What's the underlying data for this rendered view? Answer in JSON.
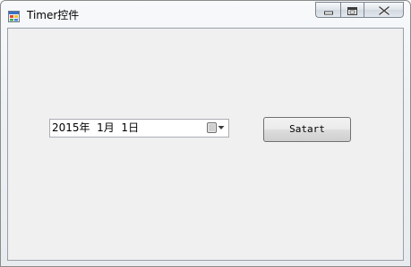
{
  "window": {
    "title": "Timer控件",
    "icons": {
      "app": "app-window-icon",
      "minimize": "minimize-icon",
      "maximize": "maximize-icon",
      "close": "close-icon"
    }
  },
  "form": {
    "date_picker": {
      "value": "2015年  1月  1日",
      "dropdown_icon": "calendar-dropdown-icon"
    },
    "start_button": {
      "label": "Satart"
    }
  }
}
